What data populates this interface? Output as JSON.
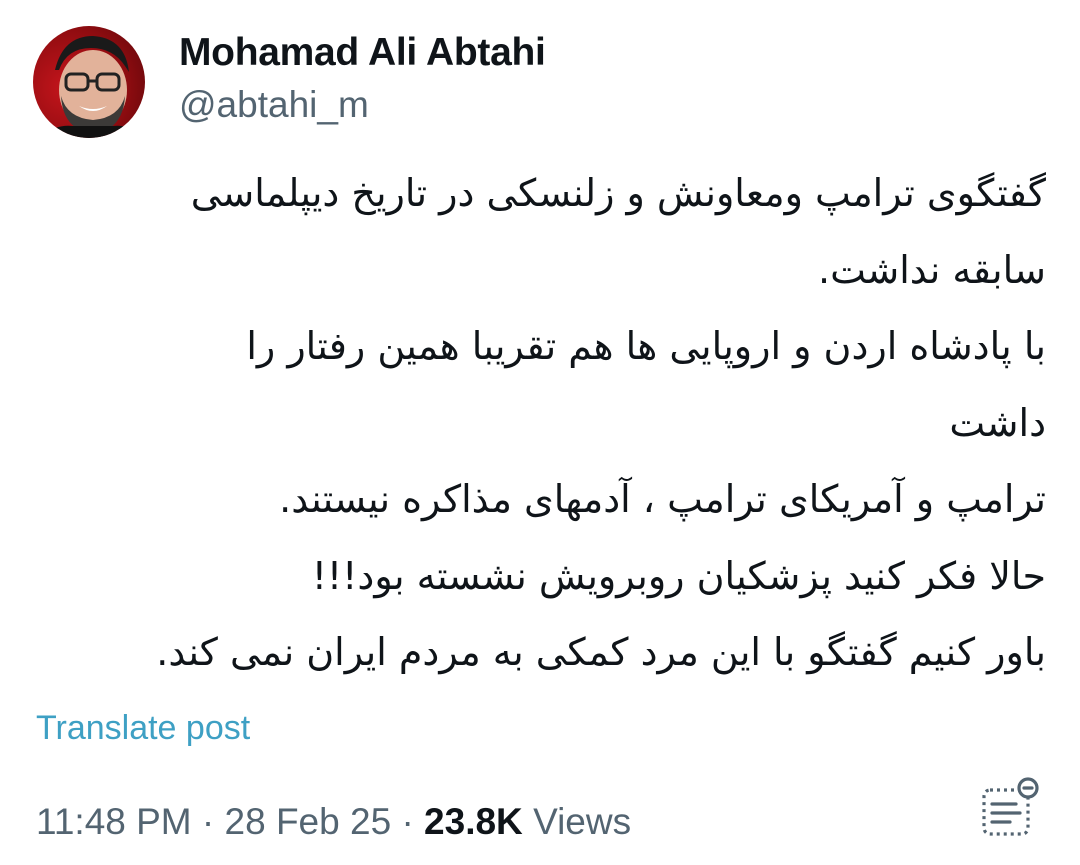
{
  "author": {
    "display_name": "Mohamad Ali Abtahi",
    "handle": "@abtahi_m"
  },
  "tweet": {
    "lines": [
      "گفتگوی ترامپ ومعاونش و زلنسکی در تاریخ دیپلماسی",
      "سابقه نداشت.",
      "با پادشاه اردن و اروپایی ها هم تقریبا همین رفتار را",
      "داشت",
      "ترامپ و آمریکای ترامپ ، آدمهای مذاکره نیستند.",
      "حالا فکر کنید پزشکیان روبرویش نشسته بود!!!",
      "باور کنیم گفتگو با این مرد کمکی به مردم ایران نمی کند."
    ]
  },
  "translate_label": "Translate post",
  "meta": {
    "time": "11:48 PM",
    "separator": "·",
    "date": "28 Feb 25",
    "views_count": "23.8K",
    "views_label": "Views"
  },
  "icons": {
    "analytics": "post-analytics-icon",
    "avatar": "profile-avatar"
  },
  "colors": {
    "link": "#3ea0c4",
    "secondary_text": "#536471",
    "primary_text": "#0f1419",
    "avatar_bg": "#c5151c"
  }
}
